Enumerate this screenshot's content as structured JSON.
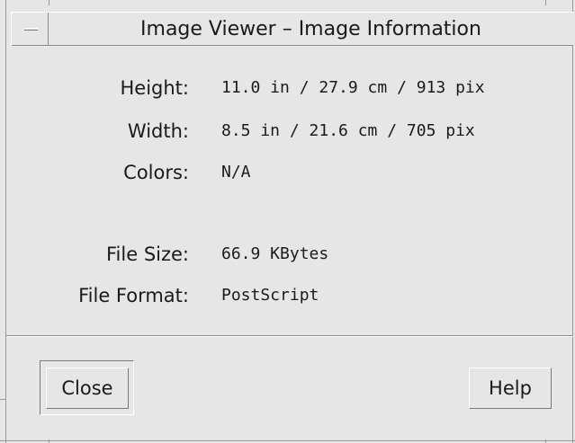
{
  "window": {
    "title": "Image Viewer – Image Information"
  },
  "info": {
    "height_label": "Height:",
    "height_value": "11.0 in / 27.9 cm / 913 pix",
    "width_label": "Width:",
    "width_value": "8.5 in / 21.6 cm / 705 pix",
    "colors_label": "Colors:",
    "colors_value": "N/A",
    "file_size_label": "File Size:",
    "file_size_value": "66.9 KBytes",
    "file_format_label": "File Format:",
    "file_format_value": "PostScript"
  },
  "buttons": {
    "close_label": "Close",
    "help_label": "Help"
  },
  "icons": {
    "window_menu": "window-menu-icon"
  },
  "colors": {
    "background": "#e6e6e6",
    "text": "#1a1a1a",
    "shadow": "#7a7a7a",
    "highlight": "#ffffff"
  }
}
